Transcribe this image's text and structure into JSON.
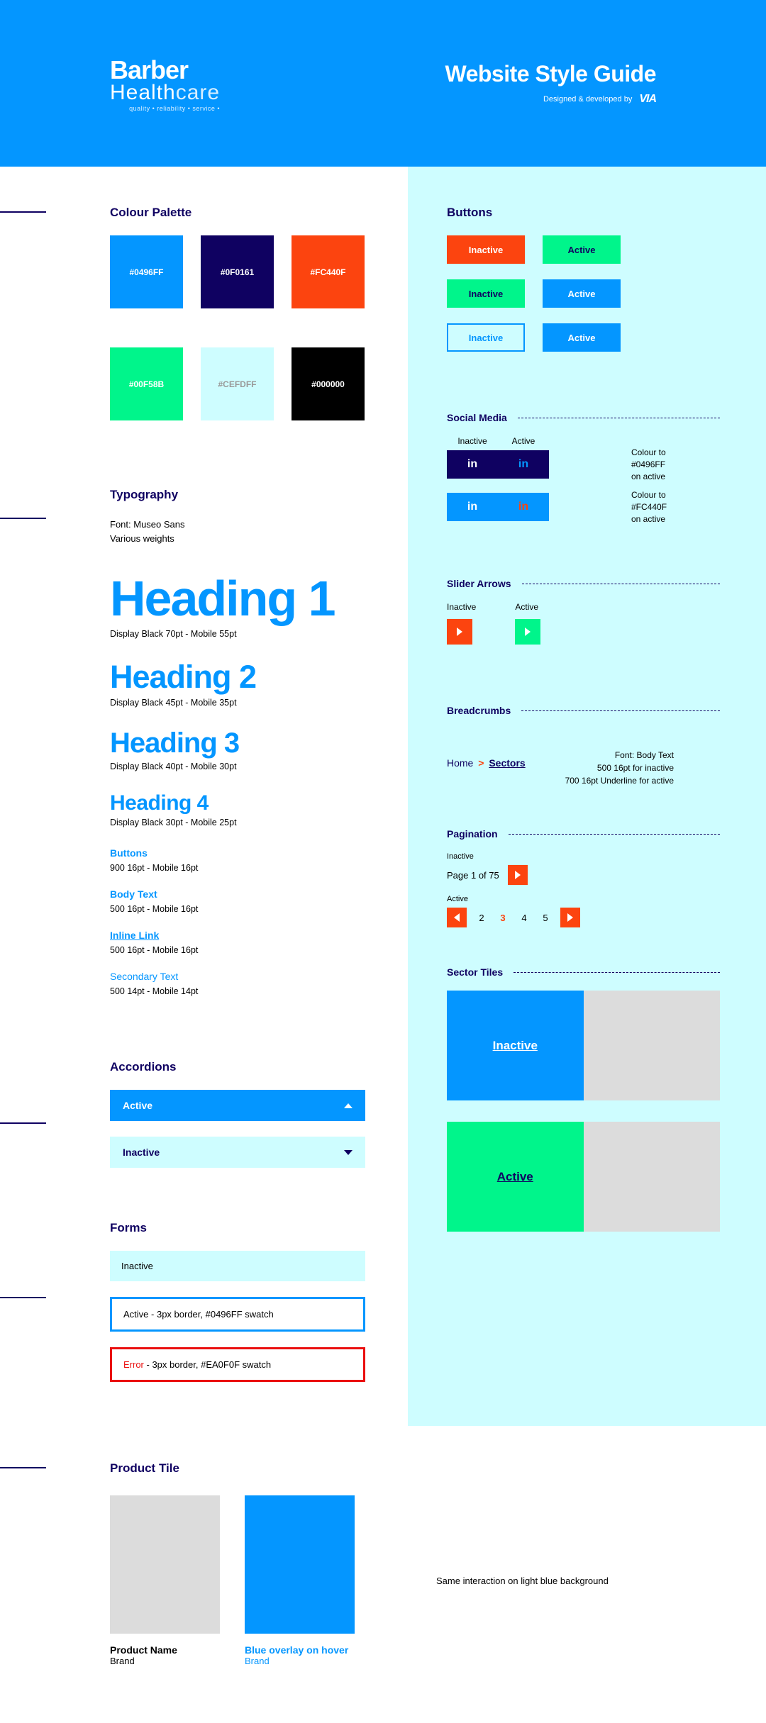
{
  "header": {
    "logo_top": "Barber",
    "logo_bottom_bold": "Health",
    "logo_bottom_thin": "care",
    "logo_tagline": "quality • reliability • service •",
    "title": "Website Style Guide",
    "subtitle": "Designed & developed by",
    "agency": "VIA"
  },
  "palette": {
    "title": "Colour Palette",
    "swatches": [
      {
        "hex": "#0496FF",
        "bg": "#0496FF",
        "fg": "#fff"
      },
      {
        "hex": "#0F0161",
        "bg": "#0F0161",
        "fg": "#fff"
      },
      {
        "hex": "#FC440F",
        "bg": "#FC440F",
        "fg": "#fff"
      },
      {
        "hex": "#00F58B",
        "bg": "#00F58B",
        "fg": "#fff"
      },
      {
        "hex": "#CEFDFF",
        "bg": "#CEFDFF",
        "fg": "#888"
      },
      {
        "hex": "#000000",
        "bg": "#000000",
        "fg": "#fff"
      }
    ]
  },
  "typography": {
    "title": "Typography",
    "font_line1": "Font: Museo Sans",
    "font_line2": "Various weights",
    "h1": "Heading 1",
    "h1_meta": "Display Black 70pt - Mobile 55pt",
    "h2": "Heading 2",
    "h2_meta": "Display Black 45pt - Mobile 35pt",
    "h3": "Heading 3",
    "h3_meta": "Display Black 40pt - Mobile 30pt",
    "h4": "Heading 4",
    "h4_meta": "Display Black 30pt - Mobile 25pt",
    "buttons_label": "Buttons",
    "buttons_spec": "900 16pt - Mobile 16pt",
    "body_label": "Body Text",
    "body_spec": "500 16pt - Mobile 16pt",
    "link_label": "Inline Link",
    "link_spec": "500 16pt - Mobile 16pt",
    "secondary_label": "Secondary Text",
    "secondary_spec": "500 14pt - Mobile 14pt"
  },
  "accordions": {
    "title": "Accordions",
    "active": "Active",
    "inactive": "Inactive"
  },
  "forms": {
    "title": "Forms",
    "inactive": "Inactive",
    "active_prefix": "Active",
    "active_suffix": " - 3px border, #0496FF swatch",
    "error_prefix": "Error",
    "error_suffix": " - 3px border, #EA0F0F swatch"
  },
  "buttons": {
    "title": "Buttons",
    "inactive": "Inactive",
    "active": "Active"
  },
  "social": {
    "title": "Social Media",
    "inactive": "Inactive",
    "active": "Active",
    "note1a": "Colour to",
    "note1b": "#0496FF",
    "note1c": "on active",
    "note2a": "Colour to",
    "note2b": "#FC440F",
    "note2c": "on active"
  },
  "slider": {
    "title": "Slider Arrows",
    "inactive": "Inactive",
    "active": "Active"
  },
  "breadcrumbs": {
    "title": "Breadcrumbs",
    "home": "Home",
    "sep": ">",
    "current": "Sectors",
    "note1": "Font: Body Text",
    "note2": "500 16pt for inactive",
    "note3": "700 16pt Underline for active"
  },
  "pagination": {
    "title": "Pagination",
    "inactive_label": "Inactive",
    "page_text": "Page 1 of 75",
    "active_label": "Active",
    "nums": [
      "2",
      "3",
      "4",
      "5"
    ]
  },
  "sector_tiles": {
    "title": "Sector Tiles",
    "inactive": "Inactive",
    "active": "Active"
  },
  "product": {
    "title": "Product Tile",
    "name1": "Product Name",
    "brand1": "Brand",
    "name2": "Blue overlay on hover",
    "brand2": "Brand",
    "note": "Same interaction on light blue background"
  }
}
